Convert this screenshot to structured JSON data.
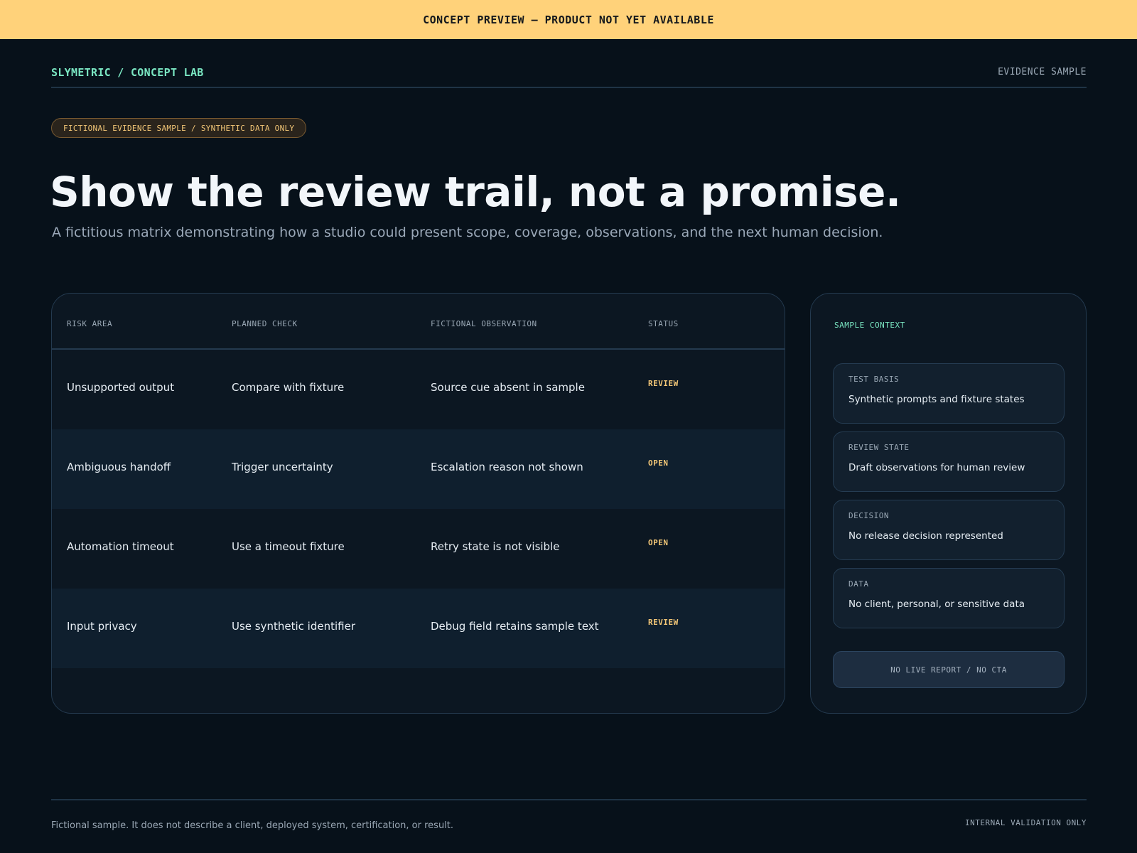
{
  "banner": {
    "text": "CONCEPT PREVIEW — PRODUCT NOT YET AVAILABLE"
  },
  "header": {
    "brand": "SLYMETRIC / CONCEPT LAB",
    "right_label": "EVIDENCE SAMPLE"
  },
  "hero": {
    "badge": "FICTIONAL EVIDENCE SAMPLE / SYNTHETIC DATA ONLY",
    "title": "Show the review trail, not a promise.",
    "subtitle": "A fictitious matrix demonstrating how a studio could present scope, coverage, observations, and the next human decision."
  },
  "matrix": {
    "columns": [
      "RISK AREA",
      "PLANNED CHECK",
      "FICTIONAL OBSERVATION",
      "STATUS"
    ],
    "rows": [
      {
        "risk": "Unsupported output",
        "check": "Compare with fixture",
        "observation": "Source cue absent in sample",
        "status": "REVIEW"
      },
      {
        "risk": "Ambiguous handoff",
        "check": "Trigger uncertainty",
        "observation": "Escalation reason not shown",
        "status": "OPEN"
      },
      {
        "risk": "Automation timeout",
        "check": "Use a timeout fixture",
        "observation": "Retry state is not visible",
        "status": "OPEN"
      },
      {
        "risk": "Input privacy",
        "check": "Use synthetic identifier",
        "observation": "Debug field retains sample text",
        "status": "REVIEW"
      }
    ]
  },
  "context": {
    "title": "SAMPLE CONTEXT",
    "cards": [
      {
        "label": "TEST BASIS",
        "value": "Synthetic prompts and fixture states"
      },
      {
        "label": "REVIEW STATE",
        "value": "Draft observations for human review"
      },
      {
        "label": "DECISION",
        "value": "No release decision represented"
      },
      {
        "label": "DATA",
        "value": "No client, personal, or sensitive data"
      }
    ],
    "footer_button": "NO LIVE REPORT / NO CTA"
  },
  "footer": {
    "note": "Fictional sample. It does not describe a client, deployed system, certification, or result.",
    "right": "INTERNAL VALIDATION ONLY"
  },
  "colors": {
    "background": "#07111a",
    "banner": "#ffd27a",
    "accent_green": "#7ae6c2",
    "status_amber": "#f2c677"
  }
}
